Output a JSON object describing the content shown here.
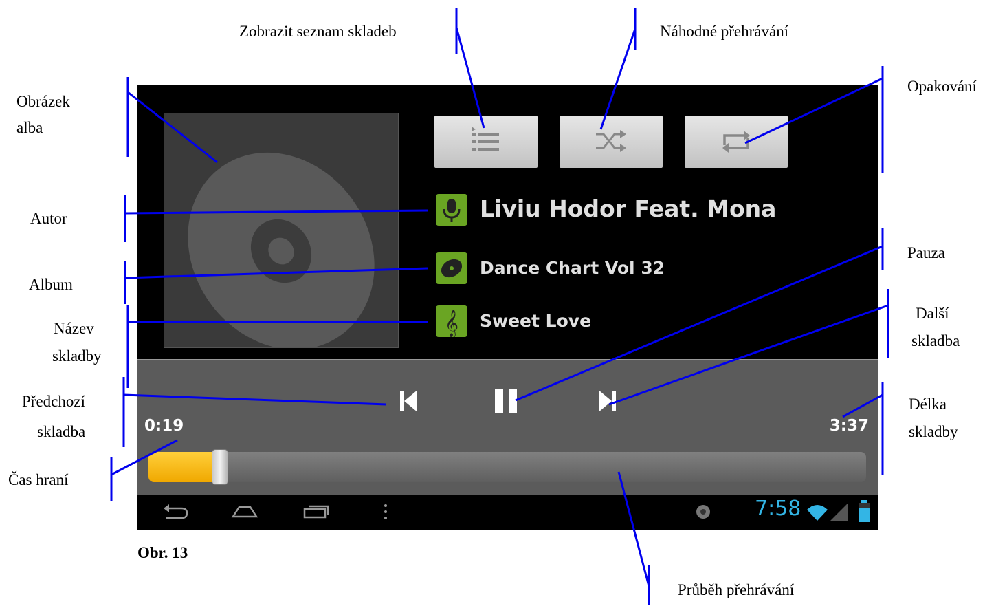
{
  "labels": {
    "playlist": "Zobrazit seznam skladeb",
    "shuffle": "Náhodné přehrávání",
    "repeat": "Opakování",
    "album_art_l1": "Obrázek",
    "album_art_l2": "alba",
    "artist": "Autor",
    "album": "Album",
    "track_name_l1": "Název",
    "track_name_l2": "skladby",
    "pause": "Pauza",
    "next_l1": "Další",
    "next_l2": "skladba",
    "prev_l1": "Předchozí",
    "prev_l2": "skladba",
    "duration_l1": "Délka",
    "duration_l2": "skladby",
    "play_time": "Čas hraní",
    "progress": "Průběh přehrávání",
    "figure": "Obr. 13"
  },
  "player": {
    "artist": "Liviu Hodor Feat. Mona",
    "album": "Dance Chart Vol 32",
    "track": "Sweet Love",
    "elapsed": "0:19",
    "total": "3:37",
    "progress": 0.088
  },
  "status_bar": {
    "clock": "7:58"
  },
  "colors": {
    "annotation_line": "#0000ee",
    "progress_fill": "#f5b400",
    "info_icon_bg": "#6aa523",
    "clock": "#33b5e5"
  },
  "icons": {
    "playlist": "list-icon",
    "shuffle": "shuffle-icon",
    "repeat": "repeat-icon",
    "artist": "microphone-icon",
    "album": "disc-icon",
    "track": "treble-clef-icon"
  }
}
